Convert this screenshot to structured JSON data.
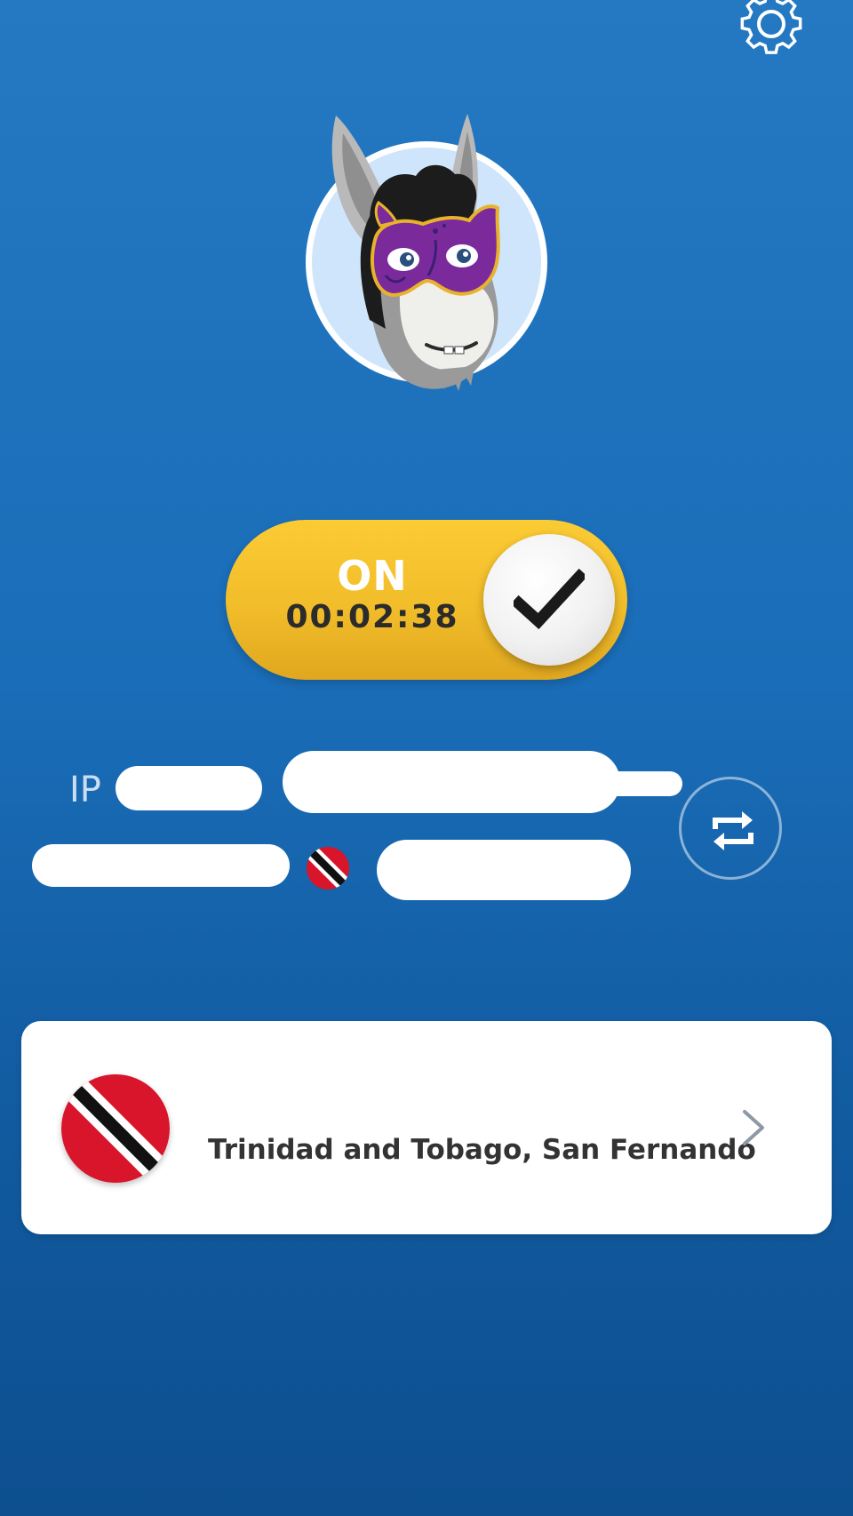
{
  "icons": {
    "settings": "gear-icon",
    "check": "checkmark-icon",
    "refresh": "swap-arrows-icon",
    "chevron": "chevron-right-icon",
    "flag": "trinidad-and-tobago-flag-icon",
    "avatar": "masked-donkey-mascot"
  },
  "colors": {
    "background_top": "#2479c2",
    "background_bottom": "#0d4f8f",
    "toggle": "#f1bd2a",
    "flag_red": "#d8152b",
    "flag_black": "#111111"
  },
  "connection": {
    "state_label": "ON",
    "timer": "00:02:38",
    "connected": true
  },
  "ip": {
    "label": "IP",
    "value_redacted": true
  },
  "location": {
    "name": "Trinidad and Tobago, San Fernando"
  }
}
